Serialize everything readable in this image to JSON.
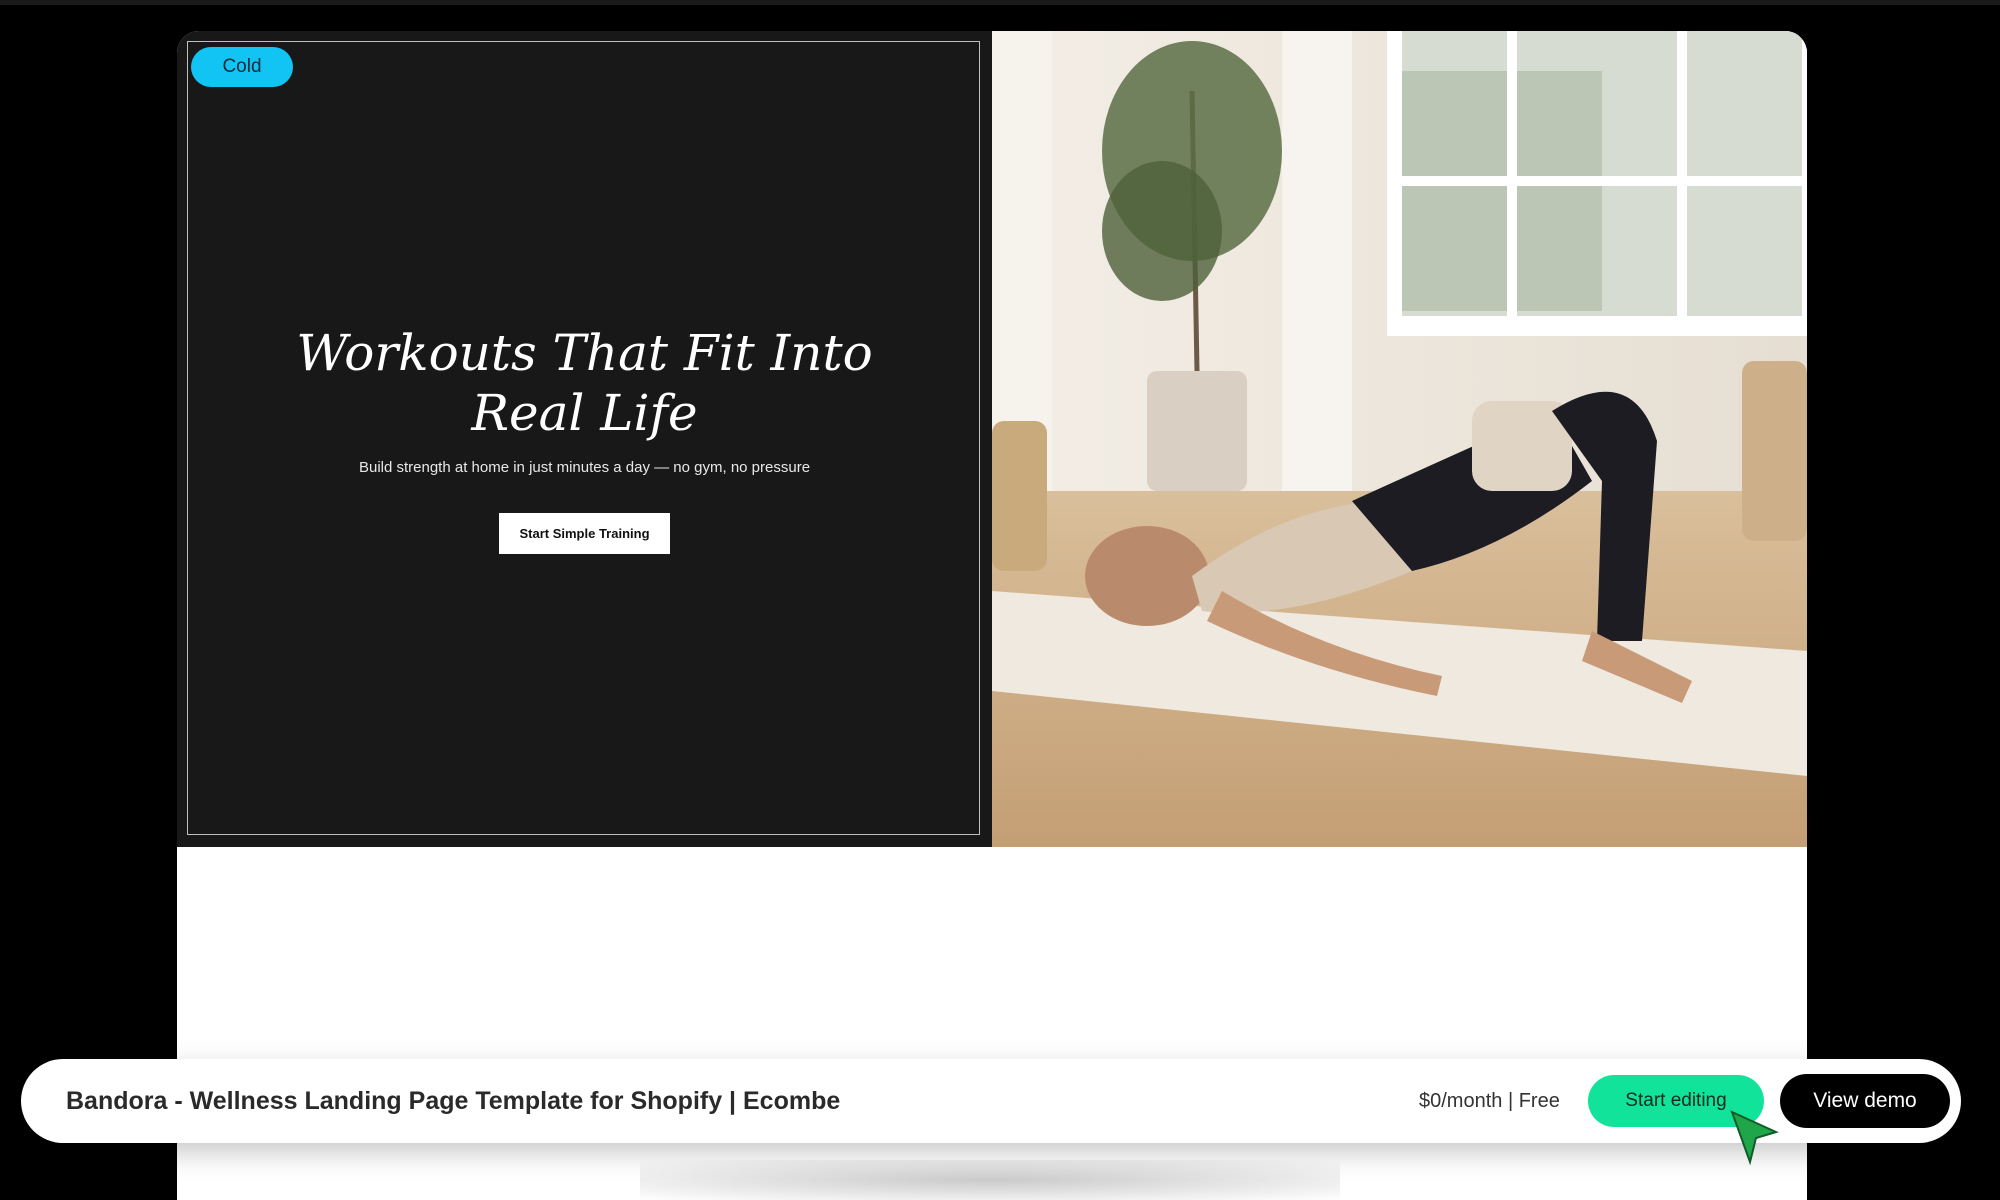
{
  "hero": {
    "badge": "Cold",
    "headline_line1": "Workouts That Fit Into",
    "headline_line2": "Real Life",
    "subline": "Build strength at home in just minutes a day — no gym, no pressure",
    "cta_label": "Start Simple Training",
    "image_label": "woman-doing-glute-bridge-on-yoga-mat"
  },
  "bar": {
    "title": "Bandora - Wellness Landing Page Template for Shopify | Ecombe",
    "price": "$0/month | Free",
    "start_editing_label": "Start editing",
    "view_demo_label": "View demo"
  },
  "colors": {
    "badge": "#12c4f4",
    "start_editing": "#12e39b",
    "view_demo": "#000000",
    "hero_left_bg": "#181818",
    "cursor": "#1fa64a"
  },
  "icons": {
    "cursor": "mouse-pointer-icon"
  }
}
